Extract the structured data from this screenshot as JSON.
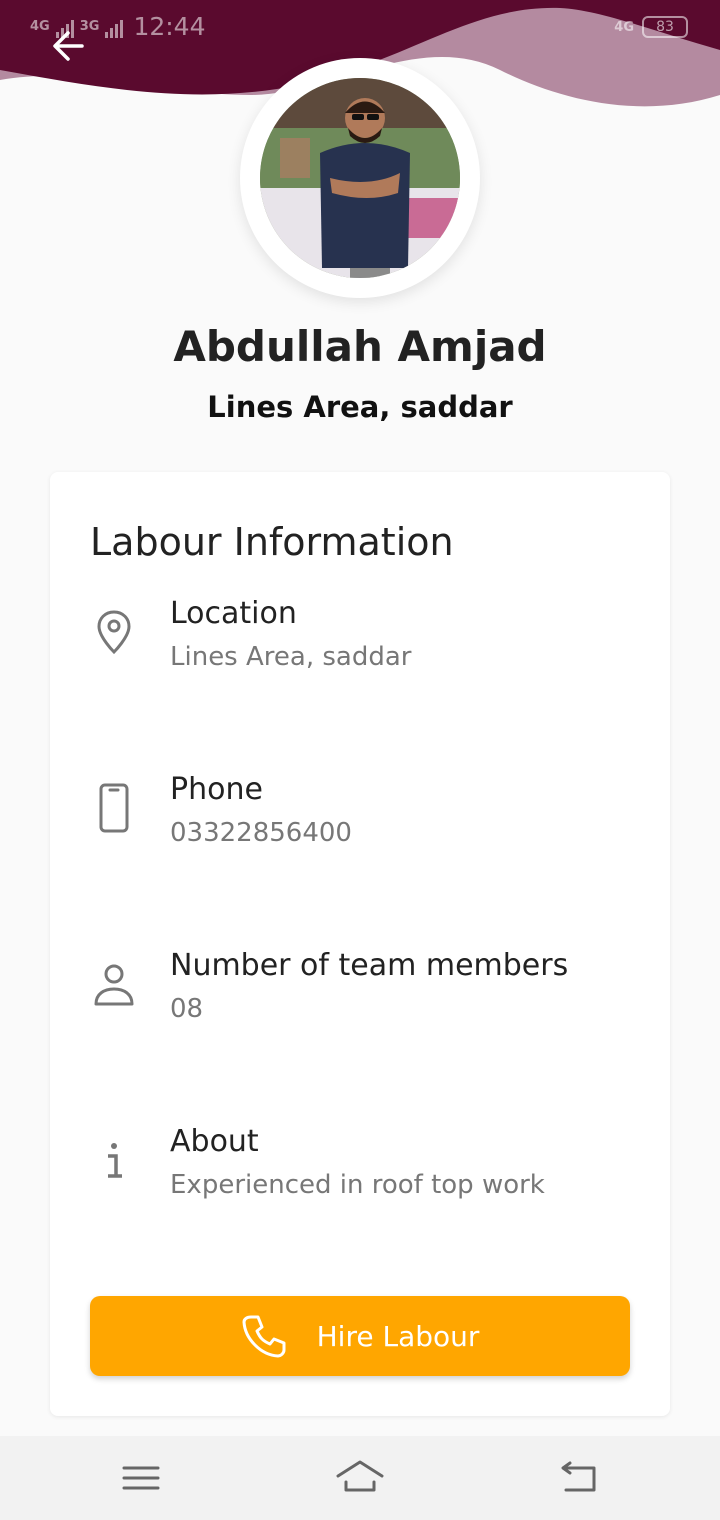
{
  "status_bar": {
    "network_1": "4G",
    "network_2": "3G",
    "time": "12:44",
    "network_right": "4G",
    "battery": "83"
  },
  "header": {
    "colors": {
      "wave_dark": "#5a0a2e",
      "wave_light": "#b48aa0"
    }
  },
  "profile": {
    "name": "Abdullah Amjad",
    "area": "Lines Area, saddar"
  },
  "card": {
    "title": "Labour Information",
    "items": [
      {
        "icon": "location-pin-icon",
        "label": "Location",
        "value": "Lines Area, saddar"
      },
      {
        "icon": "phone-device-icon",
        "label": "Phone",
        "value": "03322856400"
      },
      {
        "icon": "person-icon",
        "label": "Number of team members",
        "value": "08"
      },
      {
        "icon": "info-icon",
        "label": "About",
        "value": "Experienced in roof top work"
      }
    ],
    "hire_button": {
      "label": "Hire Labour",
      "icon": "phone-icon",
      "color": "#ffa600"
    }
  },
  "nav_bar": {
    "buttons": [
      "menu-icon",
      "home-icon",
      "back-nav-icon"
    ]
  }
}
